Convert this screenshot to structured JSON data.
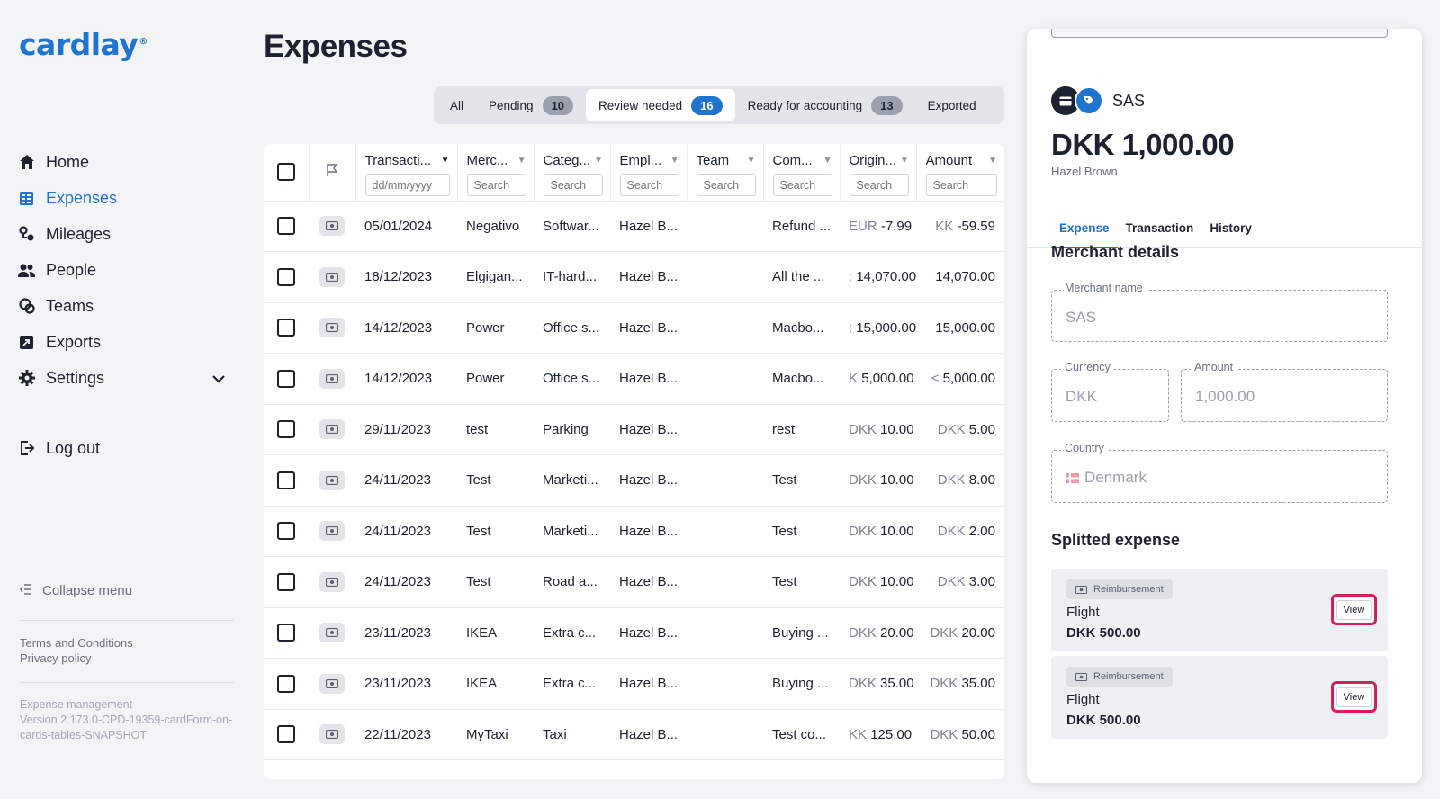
{
  "sidebar": {
    "logo": "cardlay",
    "logo_mark": "®",
    "items": [
      {
        "label": "Home",
        "icon": "home-icon"
      },
      {
        "label": "Expenses",
        "icon": "expenses-icon"
      },
      {
        "label": "Mileages",
        "icon": "mileages-icon"
      },
      {
        "label": "People",
        "icon": "people-icon"
      },
      {
        "label": "Teams",
        "icon": "teams-icon"
      },
      {
        "label": "Exports",
        "icon": "exports-icon"
      },
      {
        "label": "Settings",
        "icon": "gear-icon"
      }
    ],
    "active_item": "Expenses",
    "logout": "Log out",
    "collapse": "Collapse menu",
    "terms": "Terms and Conditions",
    "privacy": "Privacy policy",
    "version_line1": "Expense management",
    "version_line2": "Version 2.173.0-CPD-19359-cardForm-on-cards-tables-SNAPSHOT"
  },
  "main": {
    "title": "Expenses",
    "tabs": [
      {
        "label": "All",
        "count": null
      },
      {
        "label": "Pending",
        "count": "10"
      },
      {
        "label": "Review needed",
        "count": "16"
      },
      {
        "label": "Ready for accounting",
        "count": "13"
      },
      {
        "label": "Exported",
        "count": null
      }
    ],
    "active_tab": "Review needed",
    "columns": [
      {
        "label": "Transacti...",
        "placeholder": "dd/mm/yyyy"
      },
      {
        "label": "Merc...",
        "placeholder": "Search"
      },
      {
        "label": "Categ...",
        "placeholder": "Search"
      },
      {
        "label": "Empl...",
        "placeholder": "Search"
      },
      {
        "label": "Team",
        "placeholder": "Search"
      },
      {
        "label": "Com...",
        "placeholder": "Search"
      },
      {
        "label": "Origin...",
        "placeholder": "Search"
      },
      {
        "label": "Amount",
        "placeholder": "Search"
      }
    ],
    "rows": [
      {
        "date": "05/01/2024",
        "merchant": "Negativo",
        "category": "Softwar...",
        "employee": "Hazel B...",
        "team": "",
        "comment": "Refund ...",
        "orig_cur": "EUR",
        "orig_amt": "-7.99",
        "amt_cur": "KK",
        "amt": "-59.59"
      },
      {
        "date": "18/12/2023",
        "merchant": "Elgigan...",
        "category": "IT-hard...",
        "employee": "Hazel B...",
        "team": "",
        "comment": "All the ...",
        "orig_cur": ":",
        "orig_amt": "14,070.00",
        "amt_cur": "",
        "amt": "14,070.00"
      },
      {
        "date": "14/12/2023",
        "merchant": "Power",
        "category": "Office s...",
        "employee": "Hazel B...",
        "team": "",
        "comment": "Macbo...",
        "orig_cur": ":",
        "orig_amt": "15,000.00",
        "amt_cur": "",
        "amt": "15,000.00"
      },
      {
        "date": "14/12/2023",
        "merchant": "Power",
        "category": "Office s...",
        "employee": "Hazel B...",
        "team": "",
        "comment": "Macbo...",
        "orig_cur": "K",
        "orig_amt": "5,000.00",
        "amt_cur": "<",
        "amt": "5,000.00"
      },
      {
        "date": "29/11/2023",
        "merchant": "test",
        "category": "Parking",
        "employee": "Hazel B...",
        "team": "",
        "comment": "rest",
        "orig_cur": "DKK",
        "orig_amt": "10.00",
        "amt_cur": "DKK",
        "amt": "5.00"
      },
      {
        "date": "24/11/2023",
        "merchant": "Test",
        "category": "Marketi...",
        "employee": "Hazel B...",
        "team": "",
        "comment": "Test",
        "orig_cur": "DKK",
        "orig_amt": "10.00",
        "amt_cur": "DKK",
        "amt": "8.00"
      },
      {
        "date": "24/11/2023",
        "merchant": "Test",
        "category": "Marketi...",
        "employee": "Hazel B...",
        "team": "",
        "comment": "Test",
        "orig_cur": "DKK",
        "orig_amt": "10.00",
        "amt_cur": "DKK",
        "amt": "2.00"
      },
      {
        "date": "24/11/2023",
        "merchant": "Test",
        "category": "Road a...",
        "employee": "Hazel B...",
        "team": "",
        "comment": "Test",
        "orig_cur": "DKK",
        "orig_amt": "10.00",
        "amt_cur": "DKK",
        "amt": "3.00"
      },
      {
        "date": "23/11/2023",
        "merchant": "IKEA",
        "category": "Extra c...",
        "employee": "Hazel B...",
        "team": "",
        "comment": "Buying ...",
        "orig_cur": "DKK",
        "orig_amt": "20.00",
        "amt_cur": "DKK",
        "amt": "20.00"
      },
      {
        "date": "23/11/2023",
        "merchant": "IKEA",
        "category": "Extra c...",
        "employee": "Hazel B...",
        "team": "",
        "comment": "Buying ...",
        "orig_cur": "DKK",
        "orig_amt": "35.00",
        "amt_cur": "DKK",
        "amt": "35.00"
      },
      {
        "date": "22/11/2023",
        "merchant": "MyTaxi",
        "category": "Taxi",
        "employee": "Hazel B...",
        "team": "",
        "comment": "Test co...",
        "orig_cur": "KK",
        "orig_amt": "125.00",
        "amt_cur": "DKK",
        "amt": "50.00"
      }
    ]
  },
  "panel": {
    "merchant": "SAS",
    "amount": "DKK 1,000.00",
    "owner": "Hazel Brown",
    "tabs": [
      "Expense",
      "Transaction",
      "History"
    ],
    "active_tab": "Expense",
    "merchant_details_title": "Merchant details",
    "merchant_name_label": "Merchant name",
    "merchant_name_value": "SAS",
    "currency_label": "Currency",
    "currency_value": "DKK",
    "amount_label": "Amount",
    "amount_value": "1,000.00",
    "country_label": "Country",
    "country_value": "Denmark",
    "split_title": "Splitted expense",
    "splits": [
      {
        "badge": "Reimbursement",
        "title": "Flight",
        "amount": "DKK 500.00",
        "button": "View"
      },
      {
        "badge": "Reimbursement",
        "title": "Flight",
        "amount": "DKK 500.00",
        "button": "View"
      }
    ]
  },
  "colors": {
    "accent": "#1f74cf",
    "highlight": "#d61f5b"
  }
}
